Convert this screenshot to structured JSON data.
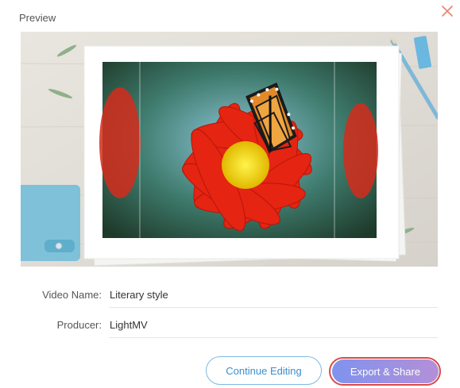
{
  "dialog": {
    "title": "Preview",
    "close_icon": "close-icon",
    "accent_color": "#e8836f"
  },
  "preview": {
    "image": "monarch-butterfly-on-red-flower-photo",
    "scene": "photo-frame-on-wooden-desk"
  },
  "form": {
    "video_name_label": "Video Name:",
    "video_name_value": "Literary style",
    "producer_label": "Producer:",
    "producer_value": "LightMV"
  },
  "actions": {
    "continue_label": "Continue Editing",
    "export_label": "Export & Share",
    "continue_color": "#3a8fcb",
    "export_gradient": [
      "#7f93ee",
      "#b48fd8"
    ]
  }
}
